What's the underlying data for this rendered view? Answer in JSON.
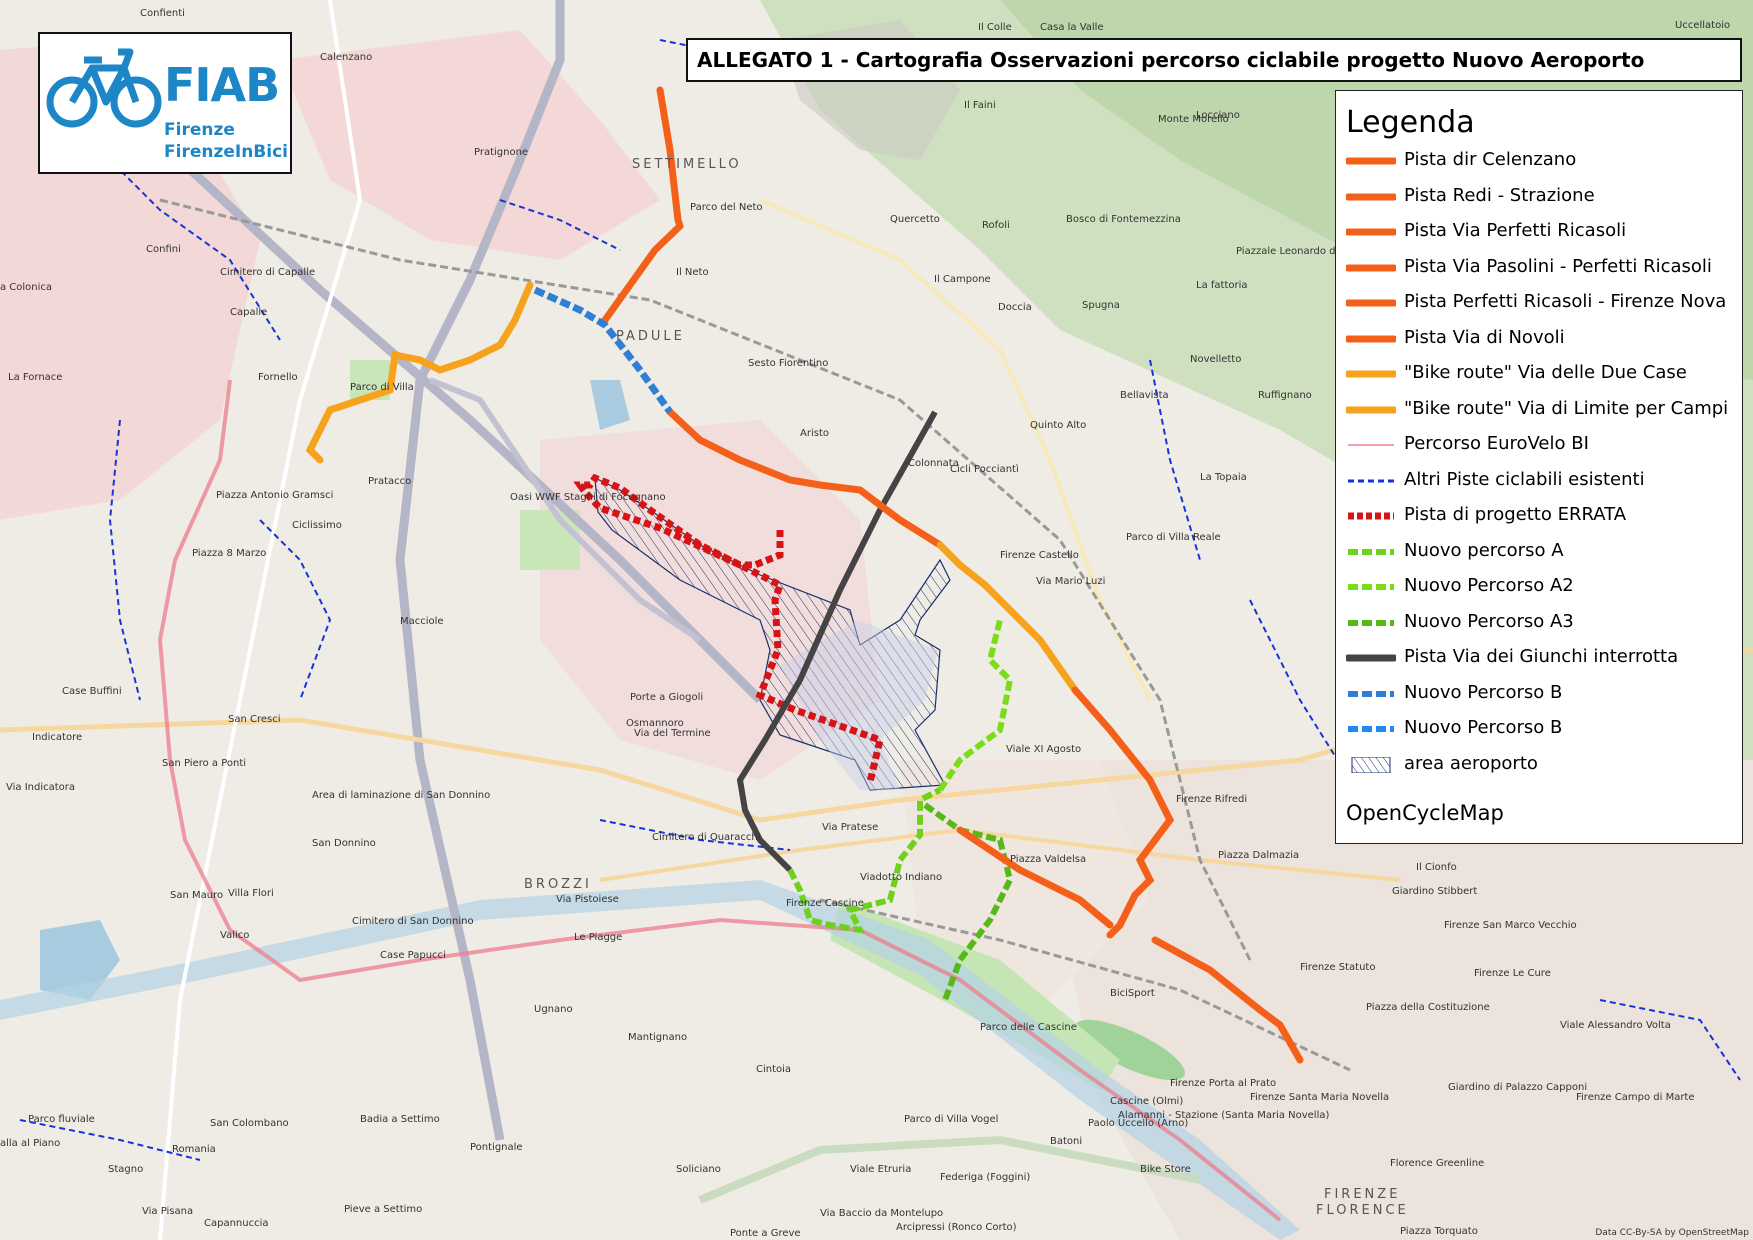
{
  "title": "ALLEGATO 1 - Cartografia Osservazioni percorso ciclabile progetto Nuovo Aeroporto",
  "logo": {
    "name": "FIAB",
    "line1": "Firenze",
    "line2": "FirenzeInBici"
  },
  "legend": {
    "title": "Legenda",
    "footer": "OpenCycleMap",
    "items": [
      {
        "label": "Pista dir Celenzano",
        "style": "solid",
        "color": "#f4601a"
      },
      {
        "label": "Pista Redi - Strazione",
        "style": "solid",
        "color": "#f4601a"
      },
      {
        "label": "Pista Via Perfetti Ricasoli",
        "style": "solid",
        "color": "#f4601a"
      },
      {
        "label": "Pista Via Pasolini - Perfetti Ricasoli",
        "style": "solid",
        "color": "#f4601a"
      },
      {
        "label": "Pista Perfetti Ricasoli  - Firenze Nova",
        "style": "solid",
        "color": "#f4601a"
      },
      {
        "label": "Pista Via di Novoli",
        "style": "solid",
        "color": "#f4601a"
      },
      {
        "label": "\"Bike route\" Via delle Due Case",
        "style": "solid",
        "color": "#f6a21d"
      },
      {
        "label": "\"Bike route\" Via di Limite per Campi",
        "style": "solid",
        "color": "#f6a21d"
      },
      {
        "label": "Percorso EuroVelo BI",
        "style": "thin",
        "color": "#f3a0ac"
      },
      {
        "label": "Altri Piste ciclabili esistenti",
        "style": "dash",
        "color": "#1535d6"
      },
      {
        "label": "Pista di progetto ERRATA",
        "style": "bigdash",
        "color": "#d61416"
      },
      {
        "label": "Nuovo percorso A",
        "style": "dashthick",
        "color": "#6fd11d"
      },
      {
        "label": "Nuovo Percorso A2",
        "style": "dashthick",
        "color": "#7bdc1a"
      },
      {
        "label": "Nuovo Percorso A3",
        "style": "dashthick",
        "color": "#58b81a"
      },
      {
        "label": "Pista Via dei Giunchi interrotta",
        "style": "solid",
        "color": "#444444"
      },
      {
        "label": "Nuovo Percorso B",
        "style": "dashthick",
        "color": "#2f7fd4"
      },
      {
        "label": "Nuovo Percorso B",
        "style": "dashthick",
        "color": "#1e8bf0"
      },
      {
        "label": "area aeroporto",
        "style": "hatch",
        "color": "#1a2f6e"
      }
    ]
  },
  "places": [
    "Confienti",
    "Calenzano",
    "Pratignone",
    "SETTIMELLO",
    "Il Colle",
    "Casa la Valle",
    "Il Faini",
    "Monte Morello",
    "Locciano",
    "Uccellatoio",
    "Confini",
    "Cimitero di Capalle",
    "Capalle",
    "Il Neto",
    "Parco del Neto",
    "Quercetto",
    "Rofoli",
    "Bosco di Fontemezzina",
    "Piazzale Leonardo da Vinci",
    "a Colonica",
    "PADULE",
    "Il Campone",
    "Doccia",
    "Spugna",
    "La fattoria",
    "Sesto Fiorentino",
    "Novelletto",
    "Ruffignano",
    "La Fornace",
    "Fornello",
    "Parco di Villa",
    "Bellavista",
    "Quinto Alto",
    "Aristo",
    "Colonnata",
    "Pratacco",
    "Ciclissimo",
    "Piazza Antonio Gramsci",
    "Oasi WWF Stagni di Focognano",
    "Cicli Pocciantì",
    "La Topaia",
    "Piazza 8 Marzo",
    "Firenze Castello",
    "Parco di Villa Reale",
    "Macciole",
    "Case Buffini",
    "San Cresci",
    "Porte a Giogoli",
    "Osmannoro",
    "Indicatore",
    "Via Indicatora",
    "San Piero a Ponti",
    "Area di laminazione di San Donnino",
    "Firenze Rifredi",
    "Viale XI Agosto",
    "San Donnino",
    "Villa Flori",
    "Cimitero di Quaracchi",
    "San Mauro",
    "BROZZI",
    "Via Pistoiese",
    "Firenze Cascine",
    "Piazza Dalmazia",
    "Il Cionfo",
    "Giardino Stibbert",
    "Cimitero di San Donnino",
    "Valico",
    "Le Piagge",
    "Case Papucci",
    "Firenze San Marco Vecchio",
    "Firenze Statuto",
    "Firenze Le Cure",
    "BiciSport",
    "Piazza della Costituzione",
    "Ugnano",
    "Mantignano",
    "Parco delle Cascine",
    "Cintoia",
    "Firenze Porta al Prato",
    "Firenze Santa Maria Novella",
    "Cascine (Olmi)",
    "Alamanni - Stazione (Santa Maria Novella)",
    "Firenze Campo di Marte",
    "Giardino di Palazzo Capponi",
    "Badia a Settimo",
    "Parco fluviale",
    "San Colombano",
    "Paolo Uccello (Arno)",
    "Parco di Villa Vogel",
    "Batoni",
    "alla al Piano",
    "Romania",
    "Pontignale",
    "Soliciano",
    "Bike Store",
    "Florence Greenline",
    "Stagno",
    "Viale Etruria",
    "Federiga (Foggini)",
    "Pieve a Settimo",
    "Capannuccia",
    "Via Pisana",
    "Via Baccio da Montelupo",
    "Ponte a Greve",
    "Arcipressi (Ronco Corto)",
    "FIRENZE",
    "FLORENCE",
    "Piazza Torquato",
    "Viale Alessandro Volta",
    "Via Pratese",
    "Piazza Valdelsa",
    "Viadotto Indiano",
    "Via del Termine",
    "Via Mario Luzi"
  ],
  "attribution": "Data CC-By-SA by OpenStreetMap"
}
